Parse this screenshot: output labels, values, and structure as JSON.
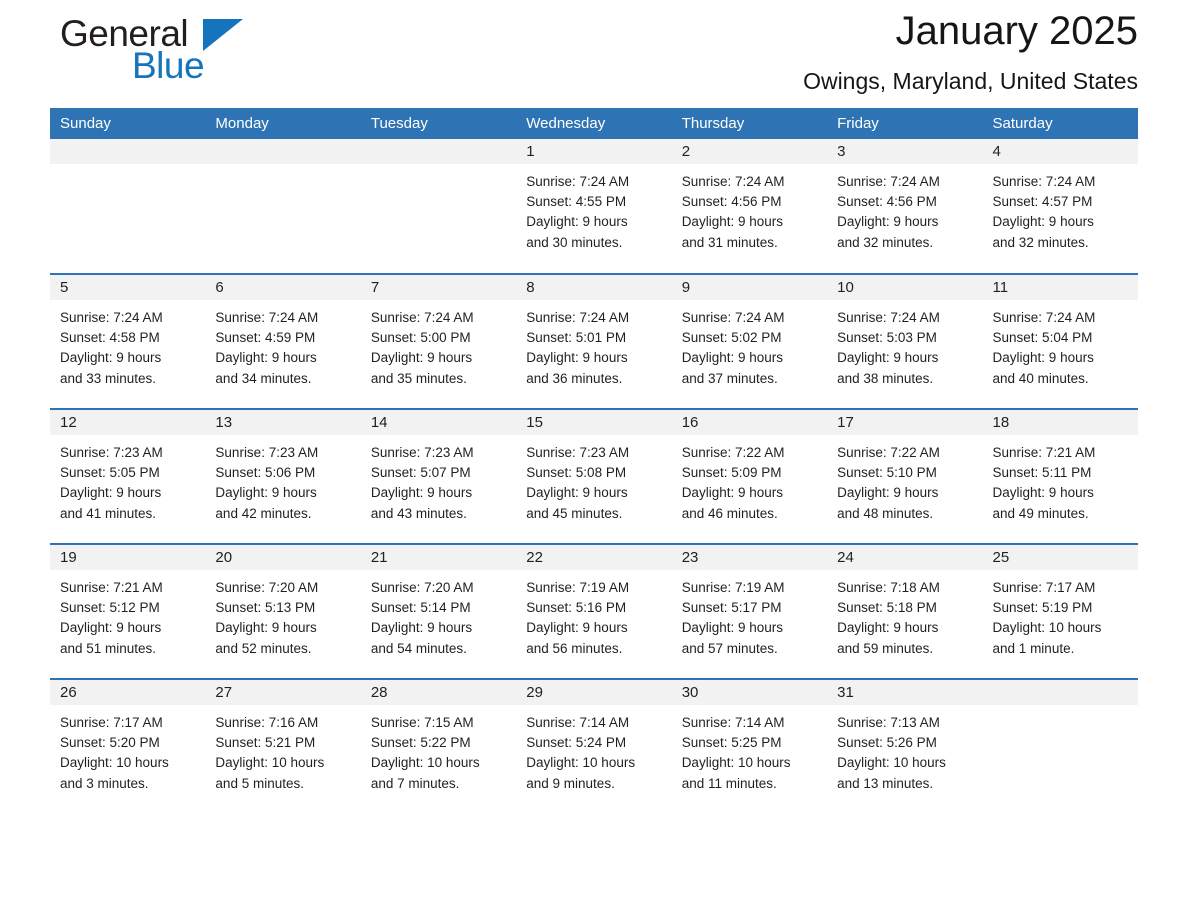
{
  "brand": {
    "name_dark": "General",
    "name_blue": "Blue",
    "triangle_color": "#1574bb"
  },
  "header": {
    "title": "January 2025",
    "subtitle": "Owings, Maryland, United States",
    "accent_color": "#2e74b5"
  },
  "weekday_headers": [
    "Sunday",
    "Monday",
    "Tuesday",
    "Wednesday",
    "Thursday",
    "Friday",
    "Saturday"
  ],
  "weeks": [
    [
      {
        "day": "",
        "lines": []
      },
      {
        "day": "",
        "lines": []
      },
      {
        "day": "",
        "lines": []
      },
      {
        "day": "1",
        "lines": [
          "Sunrise: 7:24 AM",
          "Sunset: 4:55 PM",
          "Daylight: 9 hours",
          "and 30 minutes."
        ]
      },
      {
        "day": "2",
        "lines": [
          "Sunrise: 7:24 AM",
          "Sunset: 4:56 PM",
          "Daylight: 9 hours",
          "and 31 minutes."
        ]
      },
      {
        "day": "3",
        "lines": [
          "Sunrise: 7:24 AM",
          "Sunset: 4:56 PM",
          "Daylight: 9 hours",
          "and 32 minutes."
        ]
      },
      {
        "day": "4",
        "lines": [
          "Sunrise: 7:24 AM",
          "Sunset: 4:57 PM",
          "Daylight: 9 hours",
          "and 32 minutes."
        ]
      }
    ],
    [
      {
        "day": "5",
        "lines": [
          "Sunrise: 7:24 AM",
          "Sunset: 4:58 PM",
          "Daylight: 9 hours",
          "and 33 minutes."
        ]
      },
      {
        "day": "6",
        "lines": [
          "Sunrise: 7:24 AM",
          "Sunset: 4:59 PM",
          "Daylight: 9 hours",
          "and 34 minutes."
        ]
      },
      {
        "day": "7",
        "lines": [
          "Sunrise: 7:24 AM",
          "Sunset: 5:00 PM",
          "Daylight: 9 hours",
          "and 35 minutes."
        ]
      },
      {
        "day": "8",
        "lines": [
          "Sunrise: 7:24 AM",
          "Sunset: 5:01 PM",
          "Daylight: 9 hours",
          "and 36 minutes."
        ]
      },
      {
        "day": "9",
        "lines": [
          "Sunrise: 7:24 AM",
          "Sunset: 5:02 PM",
          "Daylight: 9 hours",
          "and 37 minutes."
        ]
      },
      {
        "day": "10",
        "lines": [
          "Sunrise: 7:24 AM",
          "Sunset: 5:03 PM",
          "Daylight: 9 hours",
          "and 38 minutes."
        ]
      },
      {
        "day": "11",
        "lines": [
          "Sunrise: 7:24 AM",
          "Sunset: 5:04 PM",
          "Daylight: 9 hours",
          "and 40 minutes."
        ]
      }
    ],
    [
      {
        "day": "12",
        "lines": [
          "Sunrise: 7:23 AM",
          "Sunset: 5:05 PM",
          "Daylight: 9 hours",
          "and 41 minutes."
        ]
      },
      {
        "day": "13",
        "lines": [
          "Sunrise: 7:23 AM",
          "Sunset: 5:06 PM",
          "Daylight: 9 hours",
          "and 42 minutes."
        ]
      },
      {
        "day": "14",
        "lines": [
          "Sunrise: 7:23 AM",
          "Sunset: 5:07 PM",
          "Daylight: 9 hours",
          "and 43 minutes."
        ]
      },
      {
        "day": "15",
        "lines": [
          "Sunrise: 7:23 AM",
          "Sunset: 5:08 PM",
          "Daylight: 9 hours",
          "and 45 minutes."
        ]
      },
      {
        "day": "16",
        "lines": [
          "Sunrise: 7:22 AM",
          "Sunset: 5:09 PM",
          "Daylight: 9 hours",
          "and 46 minutes."
        ]
      },
      {
        "day": "17",
        "lines": [
          "Sunrise: 7:22 AM",
          "Sunset: 5:10 PM",
          "Daylight: 9 hours",
          "and 48 minutes."
        ]
      },
      {
        "day": "18",
        "lines": [
          "Sunrise: 7:21 AM",
          "Sunset: 5:11 PM",
          "Daylight: 9 hours",
          "and 49 minutes."
        ]
      }
    ],
    [
      {
        "day": "19",
        "lines": [
          "Sunrise: 7:21 AM",
          "Sunset: 5:12 PM",
          "Daylight: 9 hours",
          "and 51 minutes."
        ]
      },
      {
        "day": "20",
        "lines": [
          "Sunrise: 7:20 AM",
          "Sunset: 5:13 PM",
          "Daylight: 9 hours",
          "and 52 minutes."
        ]
      },
      {
        "day": "21",
        "lines": [
          "Sunrise: 7:20 AM",
          "Sunset: 5:14 PM",
          "Daylight: 9 hours",
          "and 54 minutes."
        ]
      },
      {
        "day": "22",
        "lines": [
          "Sunrise: 7:19 AM",
          "Sunset: 5:16 PM",
          "Daylight: 9 hours",
          "and 56 minutes."
        ]
      },
      {
        "day": "23",
        "lines": [
          "Sunrise: 7:19 AM",
          "Sunset: 5:17 PM",
          "Daylight: 9 hours",
          "and 57 minutes."
        ]
      },
      {
        "day": "24",
        "lines": [
          "Sunrise: 7:18 AM",
          "Sunset: 5:18 PM",
          "Daylight: 9 hours",
          "and 59 minutes."
        ]
      },
      {
        "day": "25",
        "lines": [
          "Sunrise: 7:17 AM",
          "Sunset: 5:19 PM",
          "Daylight: 10 hours",
          "and 1 minute."
        ]
      }
    ],
    [
      {
        "day": "26",
        "lines": [
          "Sunrise: 7:17 AM",
          "Sunset: 5:20 PM",
          "Daylight: 10 hours",
          "and 3 minutes."
        ]
      },
      {
        "day": "27",
        "lines": [
          "Sunrise: 7:16 AM",
          "Sunset: 5:21 PM",
          "Daylight: 10 hours",
          "and 5 minutes."
        ]
      },
      {
        "day": "28",
        "lines": [
          "Sunrise: 7:15 AM",
          "Sunset: 5:22 PM",
          "Daylight: 10 hours",
          "and 7 minutes."
        ]
      },
      {
        "day": "29",
        "lines": [
          "Sunrise: 7:14 AM",
          "Sunset: 5:24 PM",
          "Daylight: 10 hours",
          "and 9 minutes."
        ]
      },
      {
        "day": "30",
        "lines": [
          "Sunrise: 7:14 AM",
          "Sunset: 5:25 PM",
          "Daylight: 10 hours",
          "and 11 minutes."
        ]
      },
      {
        "day": "31",
        "lines": [
          "Sunrise: 7:13 AM",
          "Sunset: 5:26 PM",
          "Daylight: 10 hours",
          "and 13 minutes."
        ]
      },
      {
        "day": "",
        "lines": []
      }
    ]
  ]
}
